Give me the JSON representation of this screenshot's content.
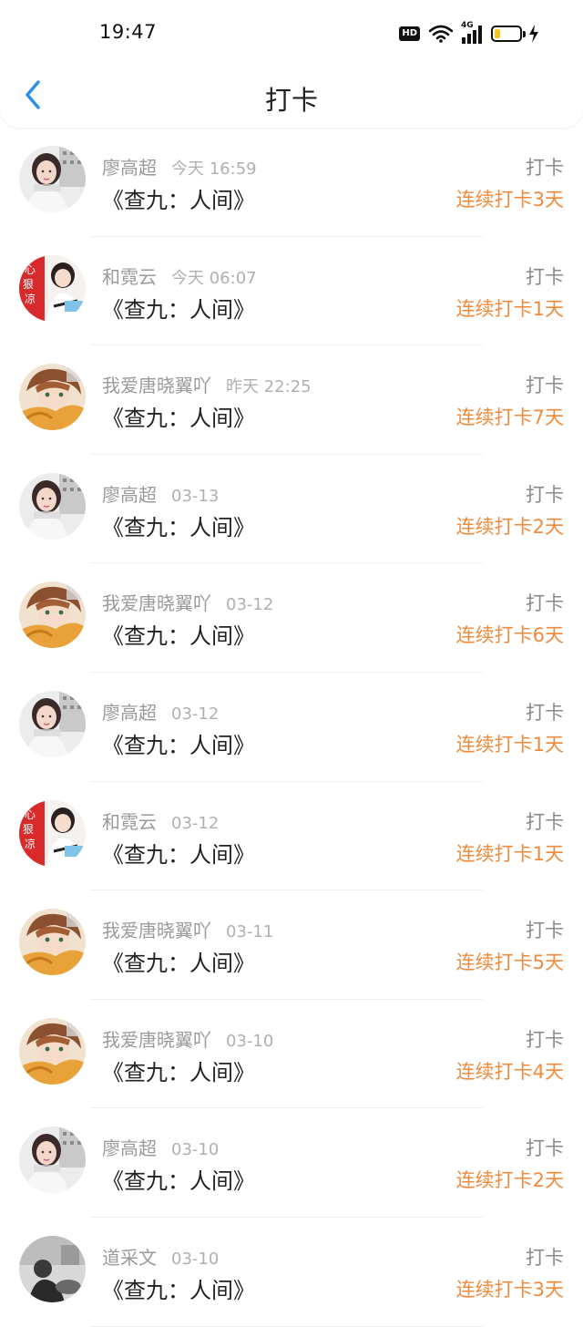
{
  "status_bar": {
    "time": "19:47",
    "hd_label": "HD",
    "network_label": "4G",
    "battery_level": 0.2,
    "charging": true
  },
  "nav": {
    "title": "打卡",
    "back_icon": "chevron-left-icon"
  },
  "colors": {
    "accent_blue": "#2a8ee8",
    "streak_orange": "#f08a3c"
  },
  "records": [
    {
      "user": "廖高超",
      "time": "今天 16:59",
      "book": "《查九：人间》",
      "tag": "打卡",
      "streak": "连续打卡3天",
      "avatar": "girl-portrait"
    },
    {
      "user": "和霓云",
      "time": "今天 06:07",
      "book": "《查九：人间》",
      "tag": "打卡",
      "streak": "连续打卡1天",
      "avatar": "anime-red"
    },
    {
      "user": "我爱唐晓翼吖",
      "time": "昨天 22:25",
      "book": "《查九：人间》",
      "tag": "打卡",
      "streak": "连续打卡7天",
      "avatar": "anime-boy"
    },
    {
      "user": "廖高超",
      "time": "03-13",
      "book": "《查九：人间》",
      "tag": "打卡",
      "streak": "连续打卡2天",
      "avatar": "girl-portrait"
    },
    {
      "user": "我爱唐晓翼吖",
      "time": "03-12",
      "book": "《查九：人间》",
      "tag": "打卡",
      "streak": "连续打卡6天",
      "avatar": "anime-boy"
    },
    {
      "user": "廖高超",
      "time": "03-12",
      "book": "《查九：人间》",
      "tag": "打卡",
      "streak": "连续打卡1天",
      "avatar": "girl-portrait"
    },
    {
      "user": "和霓云",
      "time": "03-12",
      "book": "《查九：人间》",
      "tag": "打卡",
      "streak": "连续打卡1天",
      "avatar": "anime-red"
    },
    {
      "user": "我爱唐晓翼吖",
      "time": "03-11",
      "book": "《查九：人间》",
      "tag": "打卡",
      "streak": "连续打卡5天",
      "avatar": "anime-boy"
    },
    {
      "user": "我爱唐晓翼吖",
      "time": "03-10",
      "book": "《查九：人间》",
      "tag": "打卡",
      "streak": "连续打卡4天",
      "avatar": "anime-boy"
    },
    {
      "user": "廖高超",
      "time": "03-10",
      "book": "《查九：人间》",
      "tag": "打卡",
      "streak": "连续打卡2天",
      "avatar": "girl-portrait"
    },
    {
      "user": "道采文",
      "time": "03-10",
      "book": "《查九：人间》",
      "tag": "打卡",
      "streak": "连续打卡3天",
      "avatar": "bw-photo"
    }
  ]
}
